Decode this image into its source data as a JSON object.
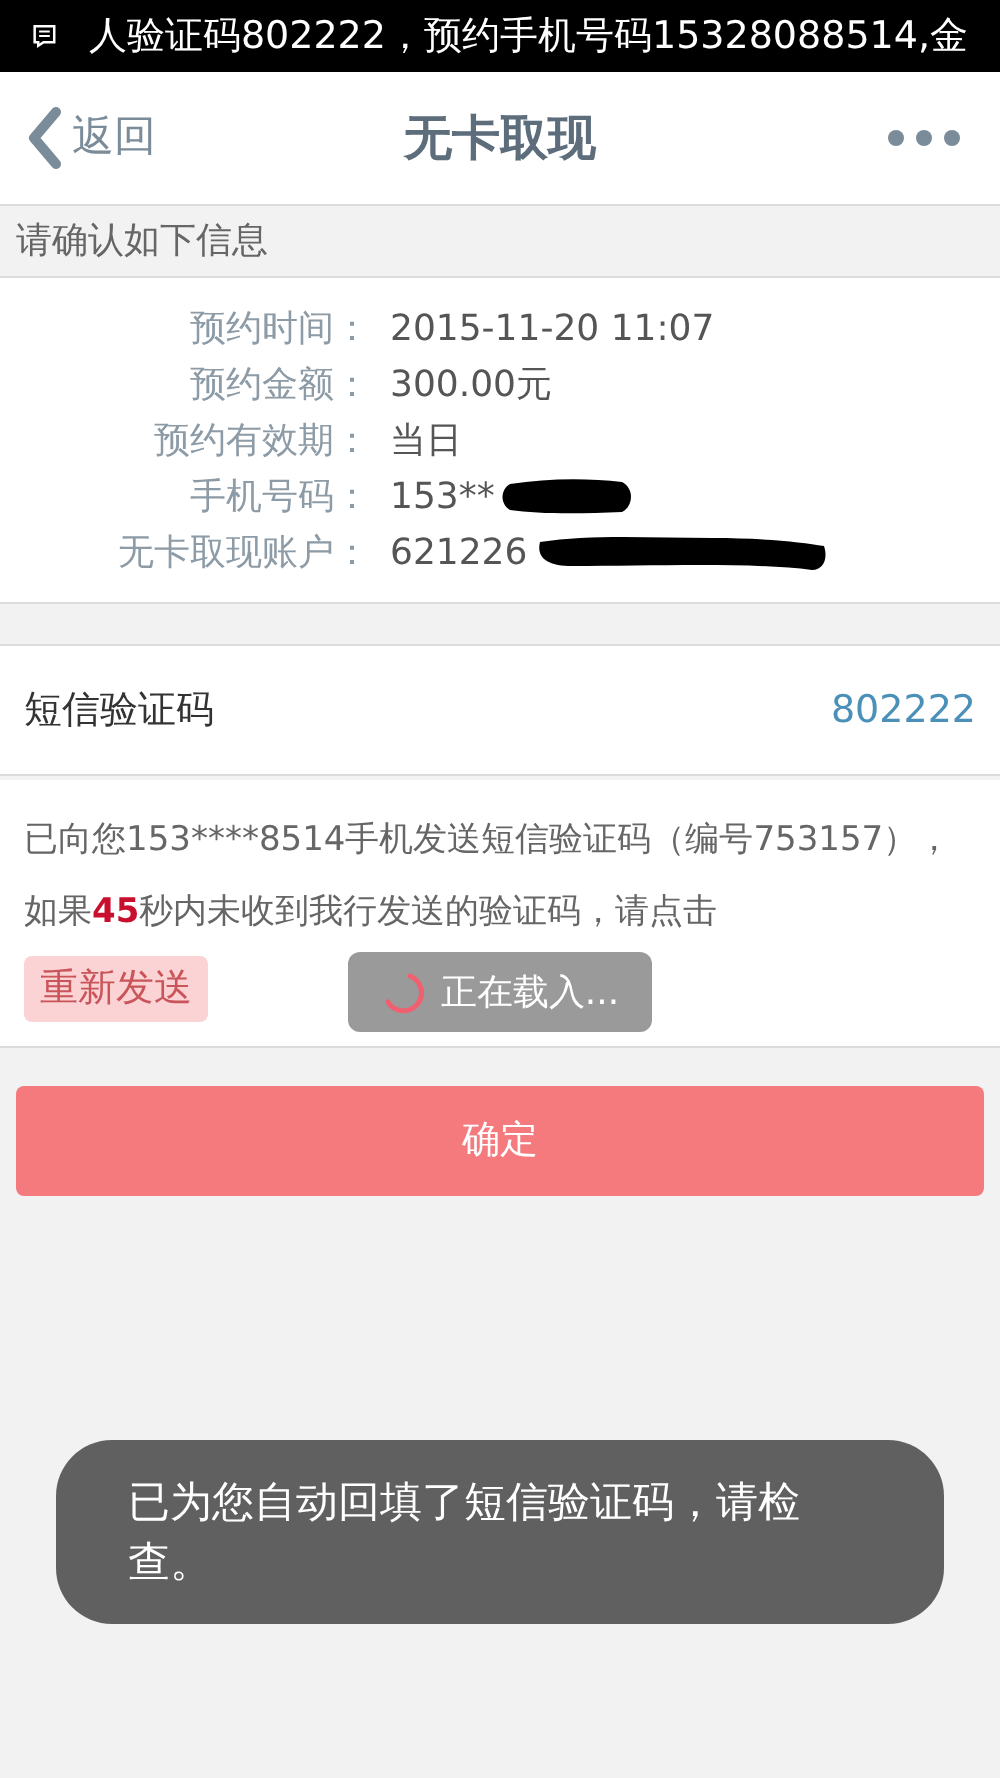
{
  "status_bar": {
    "notification": "人验证码802222，预约手机号码15328088514,金"
  },
  "header": {
    "back": "返回",
    "title": "无卡取现"
  },
  "section_title": "请确认如下信息",
  "info_rows": [
    {
      "label": "预约时间：",
      "value": "2015-11-20 11:07",
      "redacted": false
    },
    {
      "label": "预约金额：",
      "value": "300.00元",
      "redacted": false
    },
    {
      "label": "预约有效期：",
      "value": "当日",
      "redacted": false
    },
    {
      "label": "手机号码：",
      "value": "153**",
      "redacted": true
    },
    {
      "label": "无卡取现账户：",
      "value": "621226",
      "redacted": true
    }
  ],
  "sms_code": {
    "label": "短信验证码",
    "value": "802222"
  },
  "sms_notice": {
    "before": "已向您153****8514手机发送短信验证码（编号753157），如果",
    "countdown": "45",
    "after": "秒内未收到我行发送的验证码，请点击"
  },
  "resend": {
    "label": "重新发送",
    "disabled": true
  },
  "loading": {
    "text": "正在载入..."
  },
  "confirm": "确定",
  "toast": "已为您自动回填了短信验证码，请检查。"
}
